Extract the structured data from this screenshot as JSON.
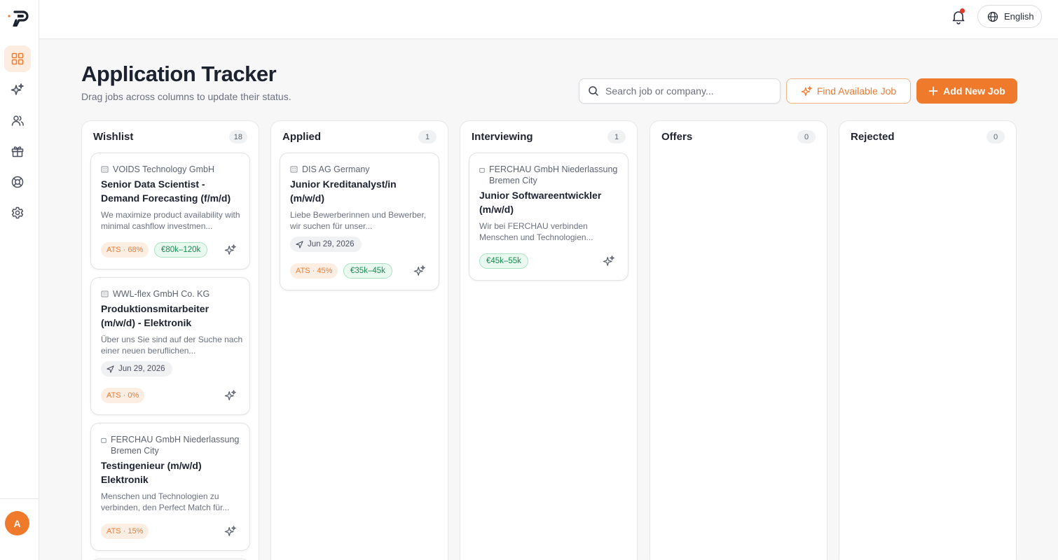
{
  "topbar": {
    "language": "English",
    "has_notification": true
  },
  "sidebar": {
    "items": [
      {
        "name": "dashboard",
        "icon": "grid-icon",
        "active": true
      },
      {
        "name": "ai",
        "icon": "sparkles-icon",
        "active": false
      },
      {
        "name": "contacts",
        "icon": "users-icon",
        "active": false
      },
      {
        "name": "rewards",
        "icon": "gift-icon",
        "active": false
      },
      {
        "name": "help",
        "icon": "lifebuoy-icon",
        "active": false
      },
      {
        "name": "settings",
        "icon": "gear-icon",
        "active": false
      }
    ],
    "avatar_initial": "A"
  },
  "header": {
    "title": "Application Tracker",
    "subtitle": "Drag jobs across columns to update their status.",
    "search_placeholder": "Search job or company...",
    "find_label": "Find Available Job",
    "add_label": "Add New Job"
  },
  "colors": {
    "accent": "#f07a2c",
    "ats_bg": "#fdeee3",
    "salary_text": "#178a52"
  },
  "columns": [
    {
      "title": "Wishlist",
      "count": "18",
      "cards": [
        {
          "company": "VOIDS Technology GmbH",
          "title": "Senior Data Scientist - Demand Forecasting (f/m/d)",
          "desc": "We maximize product availability with minimal cashflow investmen...",
          "ats": "ATS · 68%",
          "salary": "€80k–120k"
        },
        {
          "company": "WWL-flex GmbH Co. KG",
          "title": "Produktionsmitarbeiter (m/w/d) - Elektronik",
          "desc": "Über uns Sie sind auf der Suche nach einer neuen beruflichen...",
          "date": "Jun 29, 2026",
          "ats": "ATS · 0%"
        },
        {
          "company": "FERCHAU GmbH Niederlassung Bremen City",
          "title": "Testingenieur (m/w/d) Elektronik",
          "desc": "Menschen und Technologien zu verbinden, den Perfect Match für...",
          "ats": "ATS · 15%"
        }
      ]
    },
    {
      "title": "Applied",
      "count": "1",
      "cards": [
        {
          "company": "DIS AG Germany",
          "title": "Junior Kreditanalyst/in (m/w/d)",
          "desc": "Liebe Bewerberinnen und Bewerber, wir suchen für unser...",
          "date": "Jun 29, 2026",
          "ats": "ATS · 45%",
          "salary": "€35k–45k"
        }
      ]
    },
    {
      "title": "Interviewing",
      "count": "1",
      "cards": [
        {
          "company": "FERCHAU GmbH Niederlassung Bremen City",
          "title": "Junior Softwareentwickler (m/w/d)",
          "desc": "Wir bei FERCHAU verbinden Menschen und Technologien...",
          "salary": "€45k–55k"
        }
      ]
    },
    {
      "title": "Offers",
      "count": "0",
      "cards": []
    },
    {
      "title": "Rejected",
      "count": "0",
      "cards": []
    }
  ]
}
